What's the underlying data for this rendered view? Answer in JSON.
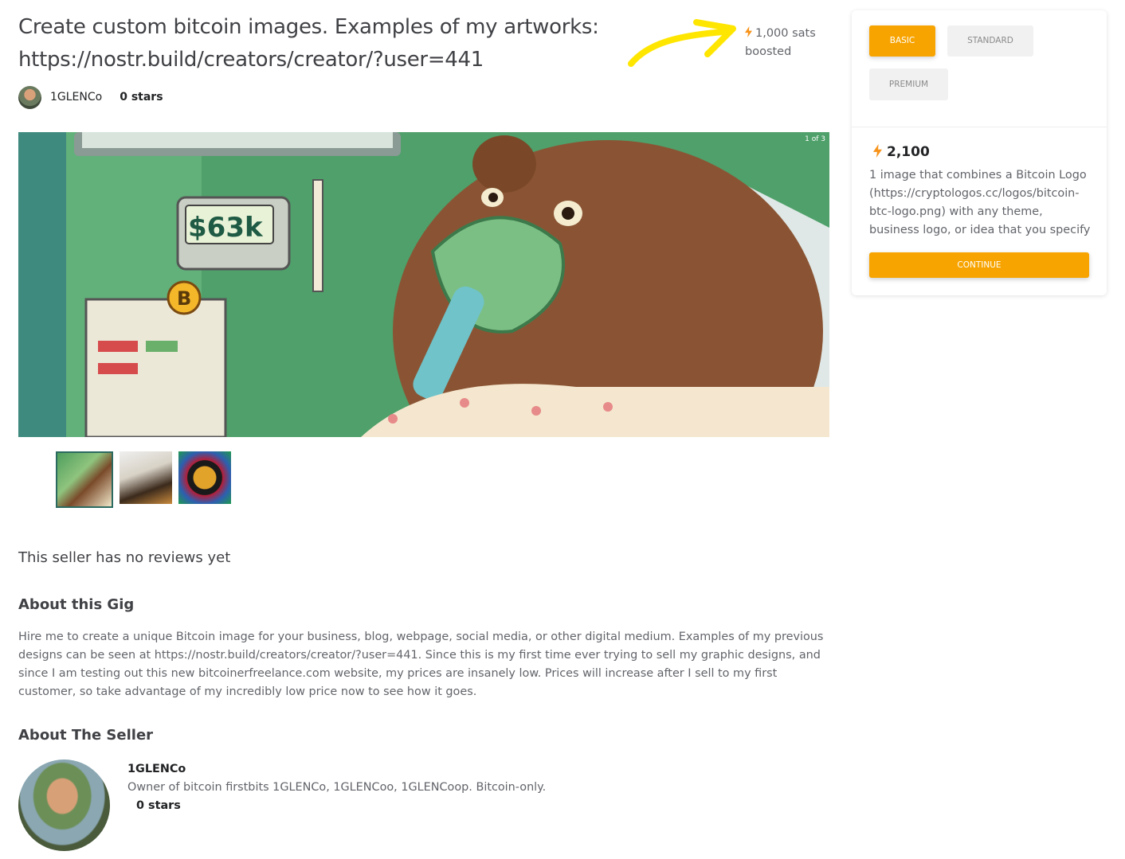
{
  "gig": {
    "title": "Create custom bitcoin images. Examples of my artworks: https://nostr.build/creators/creator/?user=441",
    "boost_amount": "1,000 sats",
    "boost_label": "boosted",
    "seller_name": "1GLENCo",
    "seller_stars": "0 stars"
  },
  "gallery": {
    "counter": "1 of 3",
    "monitor_text": "$63k",
    "thumbnails": [
      "bear-hospital",
      "cook-pancakes",
      "bitcoin-mosaic"
    ],
    "active_index": 0
  },
  "reviews": {
    "empty_text": "This seller has no reviews yet"
  },
  "about_gig": {
    "heading": "About this Gig",
    "body": "Hire me to create a unique Bitcoin image for your business, blog, webpage, social media, or other digital medium. Examples of my previous designs can be seen at https://nostr.build/creators/creator/?user=441. Since this is my first time ever trying to sell my graphic designs, and since I am testing out this new bitcoinerfreelance.com website, my prices are insanely low. Prices will increase after I sell to my first customer, so take advantage of my incredibly low price now to see how it goes."
  },
  "about_seller": {
    "heading": "About The Seller",
    "name": "1GLENCo",
    "bio": "Owner of bitcoin firstbits 1GLENCo, 1GLENCoo, 1GLENCoop. Bitcoin-only.",
    "stars": "0 stars"
  },
  "package_card": {
    "tabs": [
      "BASIC",
      "STANDARD",
      "PREMIUM"
    ],
    "selected_tab": "BASIC",
    "price": "2,100",
    "description": "1 image that combines a Bitcoin Logo (https://cryptologos.cc/logos/bitcoin-btc-logo.png) with any theme, business logo, or idea that you specify",
    "continue_label": "CONTINUE"
  },
  "colors": {
    "accent": "#f7a401",
    "bolt": "#f7931a",
    "annotation_arrow": "#ffe600"
  },
  "icons": {
    "boost": "lightning-bolt-icon",
    "price": "lightning-bolt-icon"
  }
}
